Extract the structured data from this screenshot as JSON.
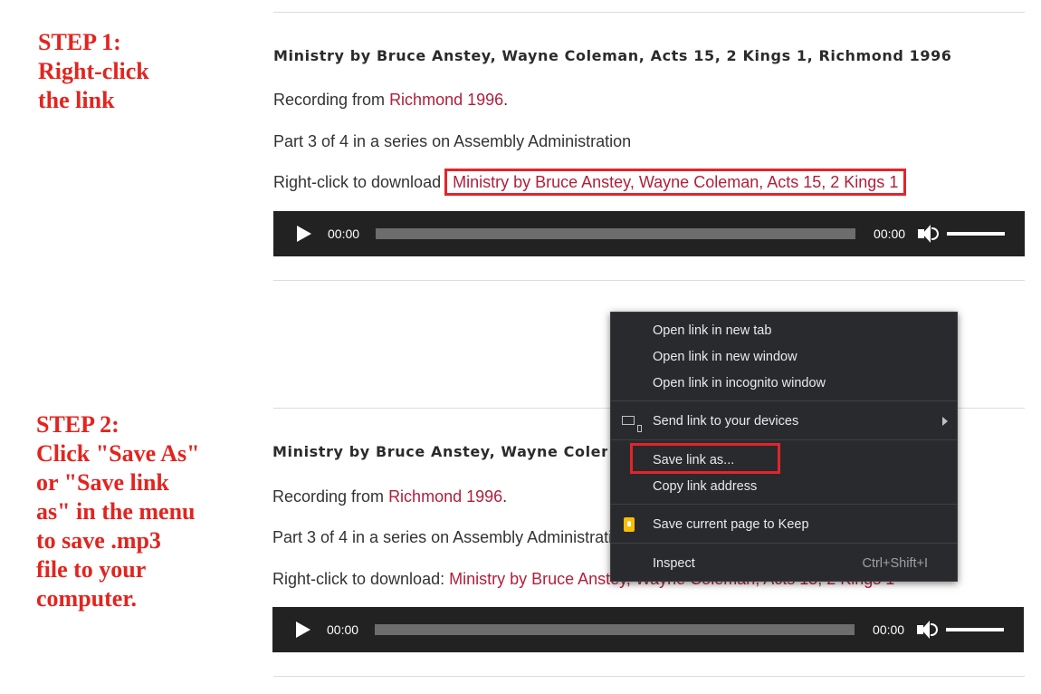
{
  "steps": {
    "step1": "STEP 1:\nRight-click\nthe link",
    "step2": "STEP 2:\nClick \"Save As\"\nor \"Save link\nas\" in the menu\nto save .mp3\nfile to your\ncomputer."
  },
  "posts": [
    {
      "title": "Ministry by Bruce Anstey, Wayne Coleman, Acts 15, 2 Kings 1, Richmond 1996",
      "recording_prefix": "Recording from ",
      "recording_link": "Richmond 1996",
      "recording_suffix": ".",
      "series": "Part 3 of 4 in a series on Assembly Administration",
      "download_prefix": "Right-click to download",
      "download_link": "Ministry by Bruce Anstey, Wayne Coleman, Acts 15, 2 Kings 1",
      "player": {
        "current_time": "00:00",
        "duration": "00:00"
      }
    },
    {
      "title": "Ministry by Bruce Anstey, Wayne Coleman, Acts 15, 2 Kings 1, Richmond 1996",
      "recording_prefix": "Recording from ",
      "recording_link": "Richmond 1996",
      "recording_suffix": ".",
      "series": "Part 3 of 4 in a series on Assembly Administration",
      "download_prefix": "Right-click to download: ",
      "download_link": "Ministry by Bruce Anstey, Wayne Coleman, Acts 15, 2 Kings 1",
      "player": {
        "current_time": "00:00",
        "duration": "00:00"
      }
    }
  ],
  "context_menu": {
    "open_new_tab": "Open link in new tab",
    "open_new_window": "Open link in new window",
    "open_incognito": "Open link in incognito window",
    "send_to_devices": "Send link to your devices",
    "save_link_as": "Save link as...",
    "copy_link_address": "Copy link address",
    "save_to_keep": "Save current page to Keep",
    "inspect": "Inspect",
    "inspect_shortcut": "Ctrl+Shift+I"
  },
  "colors": {
    "annotation": "#e3241f",
    "link": "#b11f3a",
    "menu_bg": "#292a2d",
    "player_bg": "#222222"
  }
}
